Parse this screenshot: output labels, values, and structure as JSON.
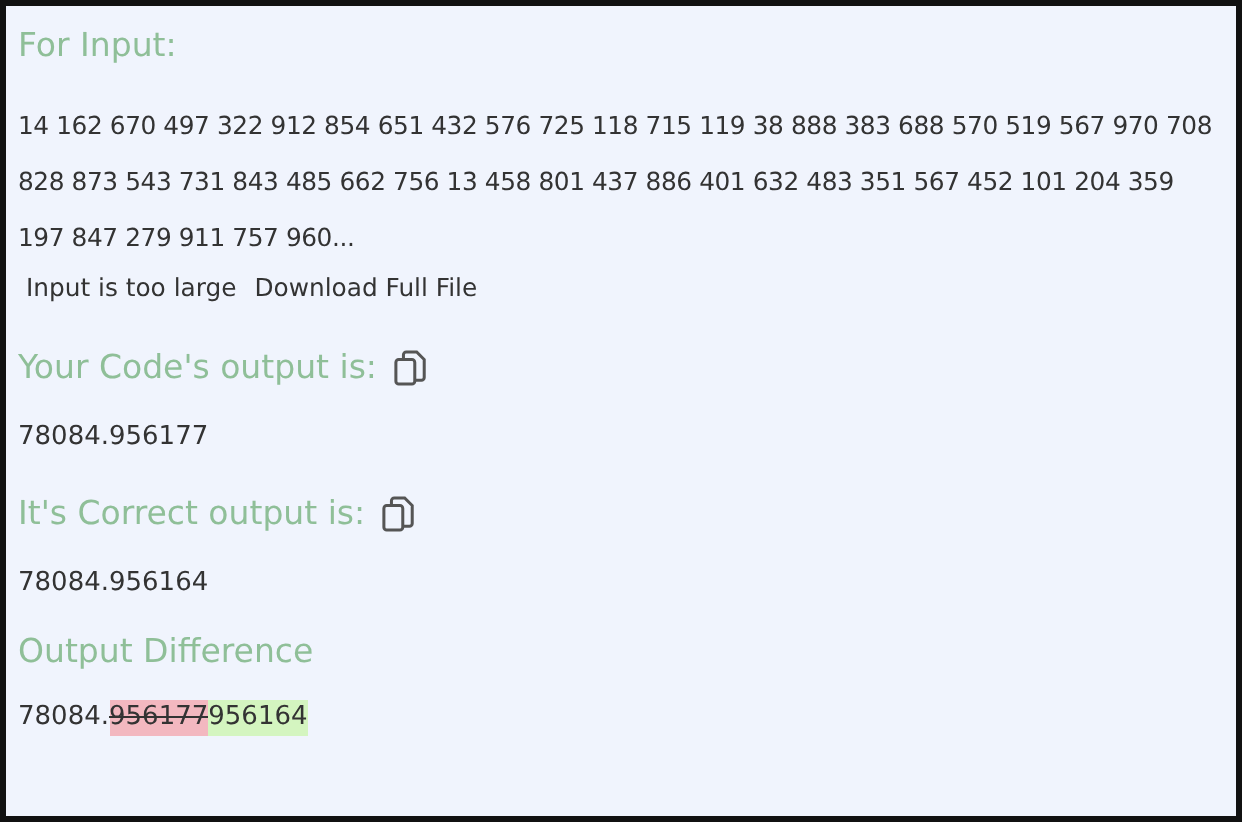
{
  "input_section": {
    "heading": "For Input:",
    "text": "14 162 670 497 322 912 854 651 432 576 725 118 715 119 38 888 383 688 570 519 567 970 708 828 873 543 731 843 485 662 756 13 458 801 437 886 401 632 483 351 567 452 101 204 359 197 847 279 911 757 960...",
    "note": "Input is too large",
    "download_label": "Download Full File"
  },
  "outputs": [
    {
      "heading": "Your Code's output is:",
      "value": "78084.956177"
    },
    {
      "heading": "It's Correct output is:",
      "value": "78084.956164"
    }
  ],
  "difference": {
    "heading": "Output Difference",
    "segments": [
      {
        "kind": "same",
        "text": "78084."
      },
      {
        "kind": "removed",
        "text": "956177"
      },
      {
        "kind": "added",
        "text": "956164"
      }
    ]
  }
}
